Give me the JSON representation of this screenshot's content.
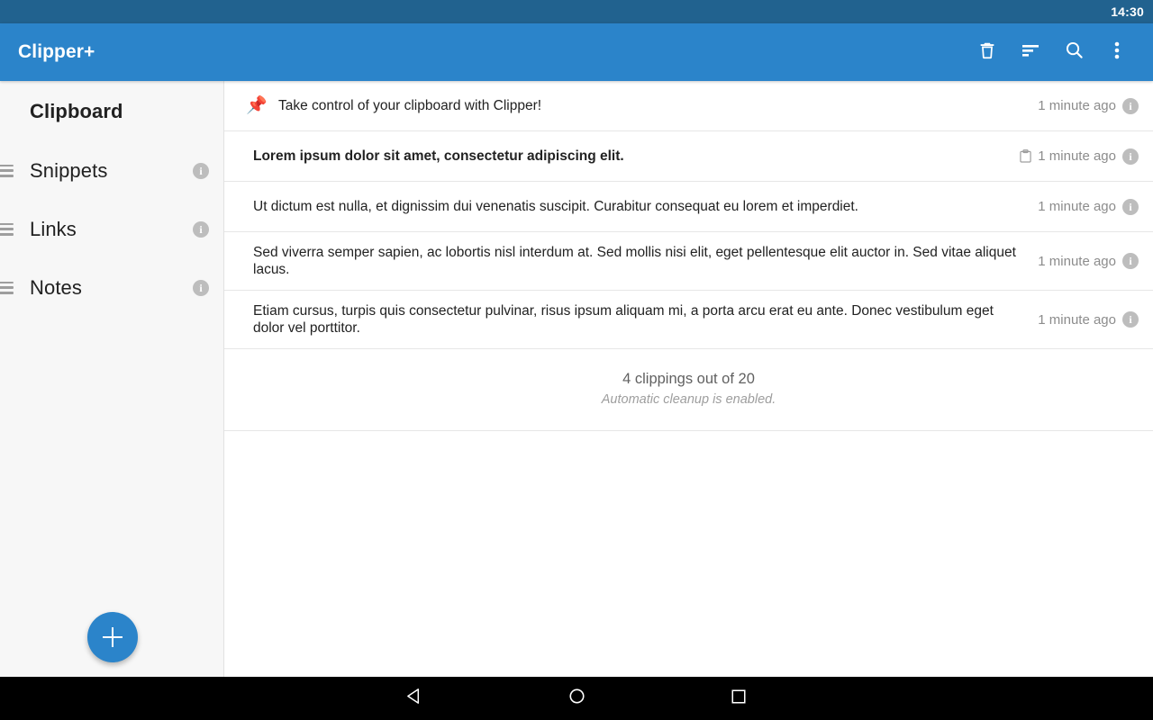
{
  "status_bar": {
    "clock": "14:30"
  },
  "app_bar": {
    "title": "Clipper+",
    "actions": [
      {
        "name": "delete-icon",
        "label": "Delete"
      },
      {
        "name": "sort-icon",
        "label": "Sort"
      },
      {
        "name": "search-icon",
        "label": "Search"
      },
      {
        "name": "overflow-menu-icon",
        "label": "More options"
      }
    ]
  },
  "sidebar": {
    "items": [
      {
        "label": "Clipboard",
        "active": true,
        "has_drag_handle": false,
        "has_info": false,
        "info_label": "i"
      },
      {
        "label": "Snippets",
        "active": false,
        "has_drag_handle": true,
        "has_info": true,
        "info_label": "i"
      },
      {
        "label": "Links",
        "active": false,
        "has_drag_handle": true,
        "has_info": true,
        "info_label": "i"
      },
      {
        "label": "Notes",
        "active": false,
        "has_drag_handle": true,
        "has_info": true,
        "info_label": "i"
      }
    ],
    "fab": {
      "label": "+",
      "name": "add-clipping-fab"
    }
  },
  "clippings": [
    {
      "text": "Take control of your clipboard with Clipper!",
      "pinned": true,
      "pin_glyph": "📌",
      "bold": false,
      "is_current_clipboard": false,
      "time": "1 minute ago",
      "info_label": "i"
    },
    {
      "text": "Lorem ipsum dolor sit amet, consectetur adipiscing elit.",
      "pinned": false,
      "pin_glyph": "",
      "bold": true,
      "is_current_clipboard": true,
      "time": "1 minute ago",
      "info_label": "i"
    },
    {
      "text": "Ut dictum est nulla, et dignissim dui venenatis suscipit. Curabitur consequat eu lorem et imperdiet.",
      "pinned": false,
      "pin_glyph": "",
      "bold": false,
      "is_current_clipboard": false,
      "time": "1 minute ago",
      "info_label": "i"
    },
    {
      "text": "Sed viverra semper sapien, ac lobortis nisl interdum at. Sed mollis nisi elit, eget pellentesque elit auctor in. Sed vitae aliquet lacus.",
      "pinned": false,
      "pin_glyph": "",
      "bold": false,
      "is_current_clipboard": false,
      "time": "1 minute ago",
      "info_label": "i"
    },
    {
      "text": "Etiam cursus, turpis quis consectetur pulvinar, risus ipsum aliquam mi, a porta arcu erat eu ante. Donec vestibulum eget dolor vel porttitor.",
      "pinned": false,
      "pin_glyph": "",
      "bold": false,
      "is_current_clipboard": false,
      "time": "1 minute ago",
      "info_label": "i"
    }
  ],
  "list_footer": {
    "count_text": "4 clippings out of 20",
    "note_text": "Automatic cleanup is enabled."
  },
  "android_nav": {
    "keys": [
      {
        "name": "back-button",
        "label": "Back"
      },
      {
        "name": "home-button",
        "label": "Home"
      },
      {
        "name": "recents-button",
        "label": "Recent apps"
      }
    ]
  },
  "colors": {
    "status_bar": "#21628f",
    "app_bar": "#2b84ca",
    "accent": "#2b84ca",
    "sidebar_bg": "#f7f7f7",
    "content_bg": "#ffffff",
    "divider": "#e6e6e6",
    "pin_red": "#e02020",
    "muted_text": "#8c8c8c",
    "nav_bar": "#000000"
  }
}
